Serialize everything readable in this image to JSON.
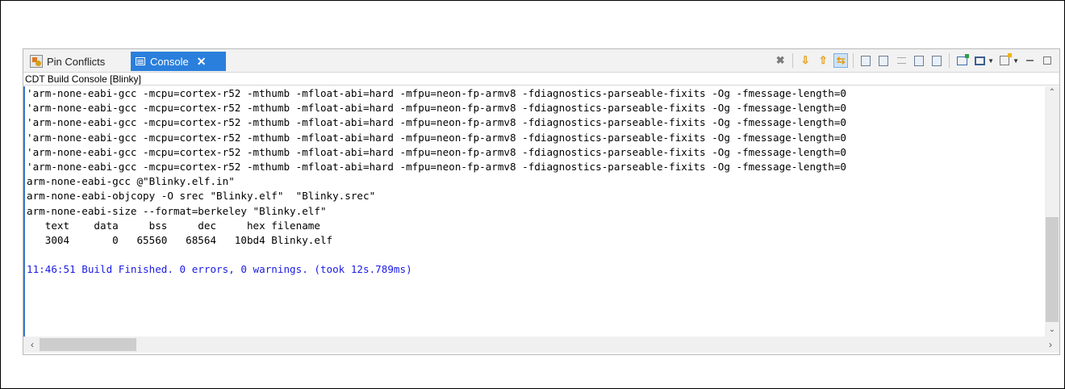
{
  "tabs": {
    "pin_conflicts": "Pin Conflicts",
    "console": "Console",
    "close_glyph": "✕"
  },
  "console_title": "CDT Build Console [Blinky]",
  "lines": [
    "'arm-none-eabi-gcc -mcpu=cortex-r52 -mthumb -mfloat-abi=hard -mfpu=neon-fp-armv8 -fdiagnostics-parseable-fixits -Og -fmessage-length=0",
    "'arm-none-eabi-gcc -mcpu=cortex-r52 -mthumb -mfloat-abi=hard -mfpu=neon-fp-armv8 -fdiagnostics-parseable-fixits -Og -fmessage-length=0",
    "'arm-none-eabi-gcc -mcpu=cortex-r52 -mthumb -mfloat-abi=hard -mfpu=neon-fp-armv8 -fdiagnostics-parseable-fixits -Og -fmessage-length=0",
    "'arm-none-eabi-gcc -mcpu=cortex-r52 -mthumb -mfloat-abi=hard -mfpu=neon-fp-armv8 -fdiagnostics-parseable-fixits -Og -fmessage-length=0",
    "'arm-none-eabi-gcc -mcpu=cortex-r52 -mthumb -mfloat-abi=hard -mfpu=neon-fp-armv8 -fdiagnostics-parseable-fixits -Og -fmessage-length=0",
    "'arm-none-eabi-gcc -mcpu=cortex-r52 -mthumb -mfloat-abi=hard -mfpu=neon-fp-armv8 -fdiagnostics-parseable-fixits -Og -fmessage-length=0",
    "arm-none-eabi-gcc @\"Blinky.elf.in\"",
    "arm-none-eabi-objcopy -O srec \"Blinky.elf\"  \"Blinky.srec\"",
    "arm-none-eabi-size --format=berkeley \"Blinky.elf\"",
    "   text    data     bss     dec     hex filename",
    "   3004       0   65560   68564   10bd4 Blinky.elf",
    "",
    "11:46:51 Build Finished. 0 errors, 0 warnings. (took 12s.789ms)"
  ],
  "scroll": {
    "up": "⌃",
    "down": "⌄",
    "left": "‹",
    "right": "›"
  },
  "colors": {
    "active_tab": "#2a7fdc",
    "finished_text": "#1a1ae6"
  }
}
